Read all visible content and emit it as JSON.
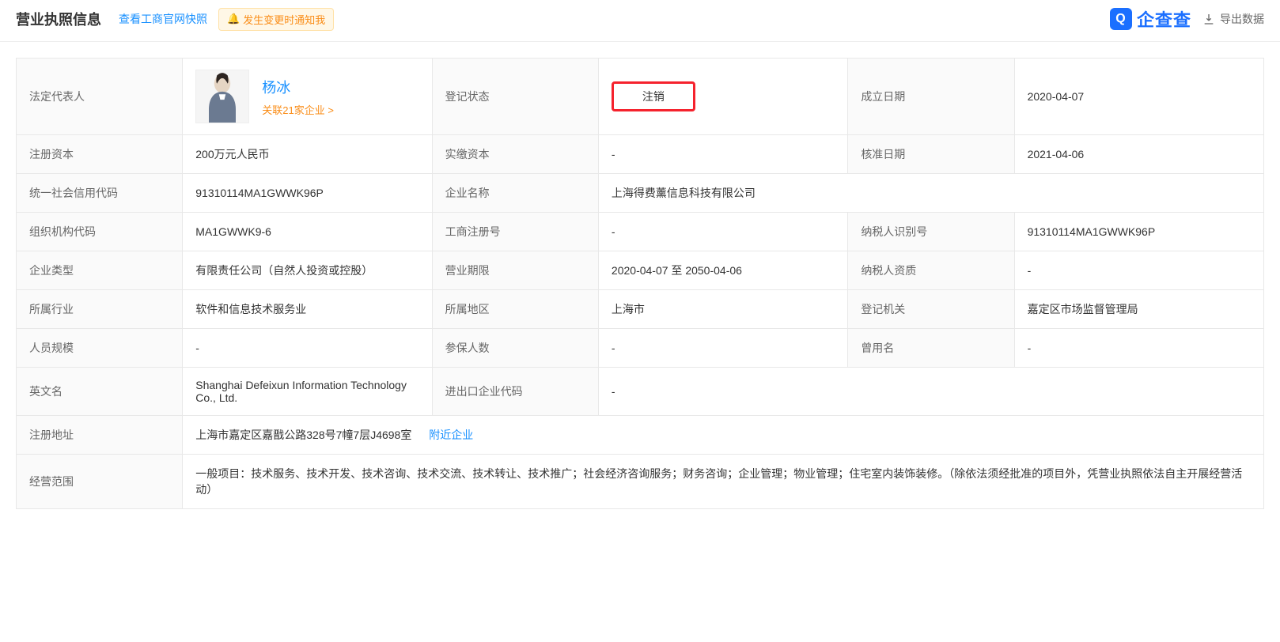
{
  "header": {
    "title": "营业执照信息",
    "snapshot_link": "查看工商官网快照",
    "notify_label": "发生变更时通知我",
    "logo_text": "企查查",
    "export_label": "导出数据"
  },
  "labels": {
    "legal_rep": "法定代表人",
    "reg_status": "登记状态",
    "estab_date": "成立日期",
    "reg_capital": "注册资本",
    "paid_capital": "实缴资本",
    "approval_date": "核准日期",
    "credit_code": "统一社会信用代码",
    "company_name": "企业名称",
    "org_code": "组织机构代码",
    "reg_no": "工商注册号",
    "tax_id": "纳税人识别号",
    "company_type": "企业类型",
    "biz_term": "营业期限",
    "tax_qual": "纳税人资质",
    "industry": "所属行业",
    "region": "所属地区",
    "reg_authority": "登记机关",
    "staff_size": "人员规模",
    "insured_num": "参保人数",
    "former_name": "曾用名",
    "english_name": "英文名",
    "import_export": "进出口企业代码",
    "reg_address": "注册地址",
    "biz_scope": "经营范围"
  },
  "legal": {
    "name": "杨冰",
    "related": "关联21家企业 >"
  },
  "values": {
    "reg_status": "注销",
    "estab_date": "2020-04-07",
    "reg_capital": "200万元人民币",
    "paid_capital": "-",
    "approval_date": "2021-04-06",
    "credit_code": "91310114MA1GWWK96P",
    "company_name": "上海得费薰信息科技有限公司",
    "org_code": "MA1GWWK9-6",
    "reg_no": "-",
    "tax_id": "91310114MA1GWWK96P",
    "company_type": "有限责任公司（自然人投资或控股）",
    "biz_term": "2020-04-07 至 2050-04-06",
    "tax_qual": "-",
    "industry": "软件和信息技术服务业",
    "region": "上海市",
    "reg_authority": "嘉定区市场监督管理局",
    "staff_size": "-",
    "insured_num": "-",
    "former_name": "-",
    "english_name": "Shanghai Defeixun Information Technology Co., Ltd.",
    "import_export": "-",
    "reg_address": "上海市嘉定区嘉戬公路328号7幢7层J4698室",
    "nearby_label": "附近企业",
    "biz_scope": "一般项目：技术服务、技术开发、技术咨询、技术交流、技术转让、技术推广；社会经济咨询服务；财务咨询；企业管理；物业管理；住宅室内装饰装修。（除依法须经批准的项目外，凭营业执照依法自主开展经营活动）"
  }
}
